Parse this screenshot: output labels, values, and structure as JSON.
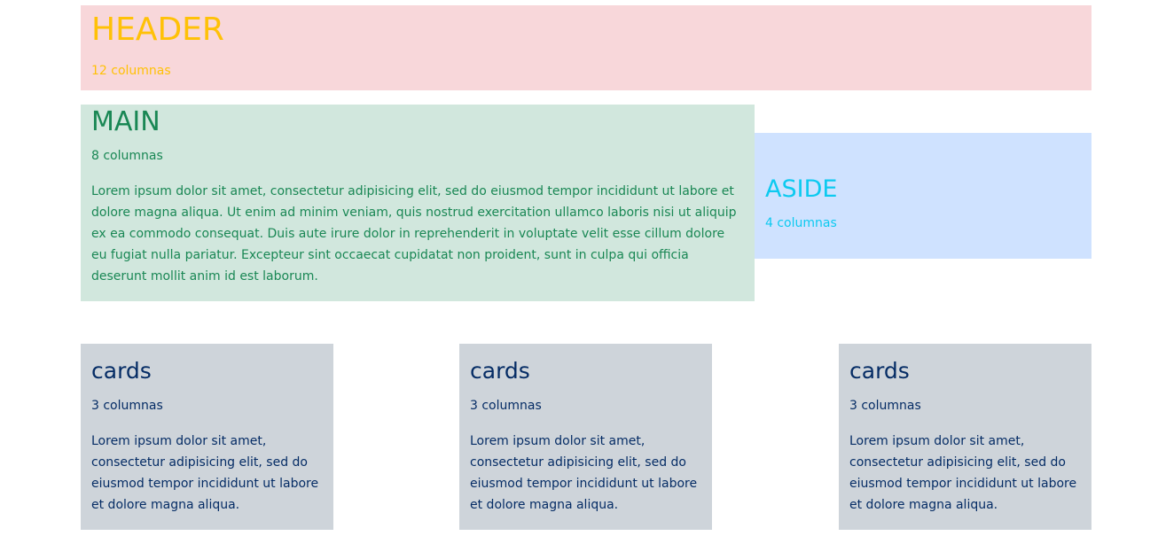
{
  "header": {
    "title": "HEADER",
    "subtitle": "12 columnas"
  },
  "main": {
    "title": "MAIN",
    "subtitle": "8 columnas",
    "text": "Lorem ipsum dolor sit amet, consectetur adipisicing elit, sed do eiusmod tempor incididunt ut labore et dolore magna aliqua. Ut enim ad minim veniam, quis nostrud exercitation ullamco laboris nisi ut aliquip ex ea commodo consequat. Duis aute irure dolor in reprehenderit in voluptate velit esse cillum dolore eu fugiat nulla pariatur. Excepteur sint occaecat cupidatat non proident, sunt in culpa qui officia deserunt mollit anim id est laborum."
  },
  "aside": {
    "title": "ASIDE",
    "subtitle": "4 columnas"
  },
  "cards": [
    {
      "title": "cards",
      "subtitle": "3 columnas",
      "text": "Lorem ipsum dolor sit amet, consectetur adipisicing elit, sed do eiusmod tempor incididunt ut labore et dolore magna aliqua."
    },
    {
      "title": "cards",
      "subtitle": "3 columnas",
      "text": "Lorem ipsum dolor sit amet, consectetur adipisicing elit, sed do eiusmod tempor incididunt ut labore et dolore magna aliqua."
    },
    {
      "title": "cards",
      "subtitle": "3 columnas",
      "text": "Lorem ipsum dolor sit amet, consectetur adipisicing elit, sed do eiusmod tempor incididunt ut labore et dolore magna aliqua."
    }
  ],
  "colors": {
    "header_bg": "#f8d7da",
    "header_text": "#ffc107",
    "main_bg": "#d1e7dd",
    "main_text": "#198754",
    "aside_bg": "#cfe2ff",
    "aside_text": "#0dcaf0",
    "card_bg": "#ced4da",
    "card_text": "#052c65"
  }
}
